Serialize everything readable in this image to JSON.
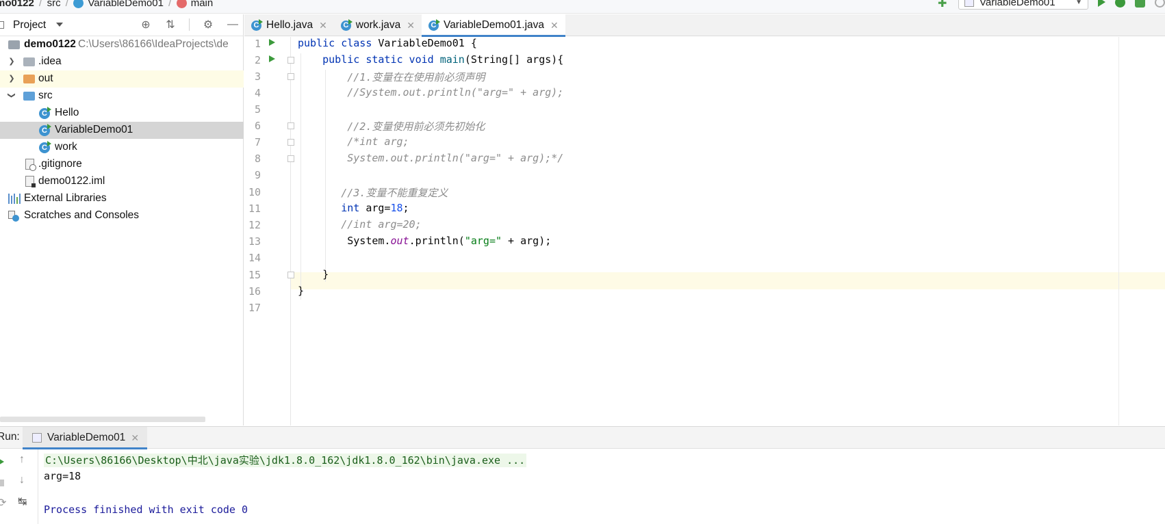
{
  "breadcrumb": {
    "project": "mo0122",
    "folder": "src",
    "class": "VariableDemo01",
    "method": "main"
  },
  "toolbar": {
    "run_config": "VariableDemo01"
  },
  "project_panel": {
    "title": "Project",
    "tree": [
      {
        "label": "demo0122",
        "path": "C:\\Users\\86166\\IdeaProjects\\de",
        "type": "module"
      },
      {
        "label": ".idea",
        "type": "folder"
      },
      {
        "label": "out",
        "type": "folder-excluded"
      },
      {
        "label": "src",
        "type": "folder-source"
      },
      {
        "label": "Hello",
        "type": "class"
      },
      {
        "label": "VariableDemo01",
        "type": "class"
      },
      {
        "label": "work",
        "type": "class"
      },
      {
        "label": ".gitignore",
        "type": "file"
      },
      {
        "label": "demo0122.iml",
        "type": "file"
      },
      {
        "label": "External Libraries",
        "type": "libraries"
      },
      {
        "label": "Scratches and Consoles",
        "type": "scratches"
      }
    ]
  },
  "tabs": [
    {
      "label": "Hello.java",
      "active": false
    },
    {
      "label": "work.java",
      "active": false
    },
    {
      "label": "VariableDemo01.java",
      "active": true
    }
  ],
  "editor": {
    "line_numbers": [
      "1",
      "2",
      "3",
      "4",
      "5",
      "6",
      "7",
      "8",
      "9",
      "10",
      "11",
      "12",
      "13",
      "14",
      "15",
      "16",
      "17"
    ]
  },
  "run_panel": {
    "label": "Run:",
    "tab_label": "VariableDemo01",
    "console": {
      "command": "C:\\Users\\86166\\Desktop\\中北\\java实验\\jdk1.8.0_162\\jdk1.8.0_162\\bin\\java.exe ...",
      "output": "arg=18",
      "exit": "Process finished with exit code 0"
    }
  },
  "colors": {
    "keyword": "#0033b3",
    "comment": "#8c8c8c",
    "string": "#067d17",
    "number": "#1750eb",
    "accent": "#4083c9",
    "run_green": "#3c9a3c"
  }
}
